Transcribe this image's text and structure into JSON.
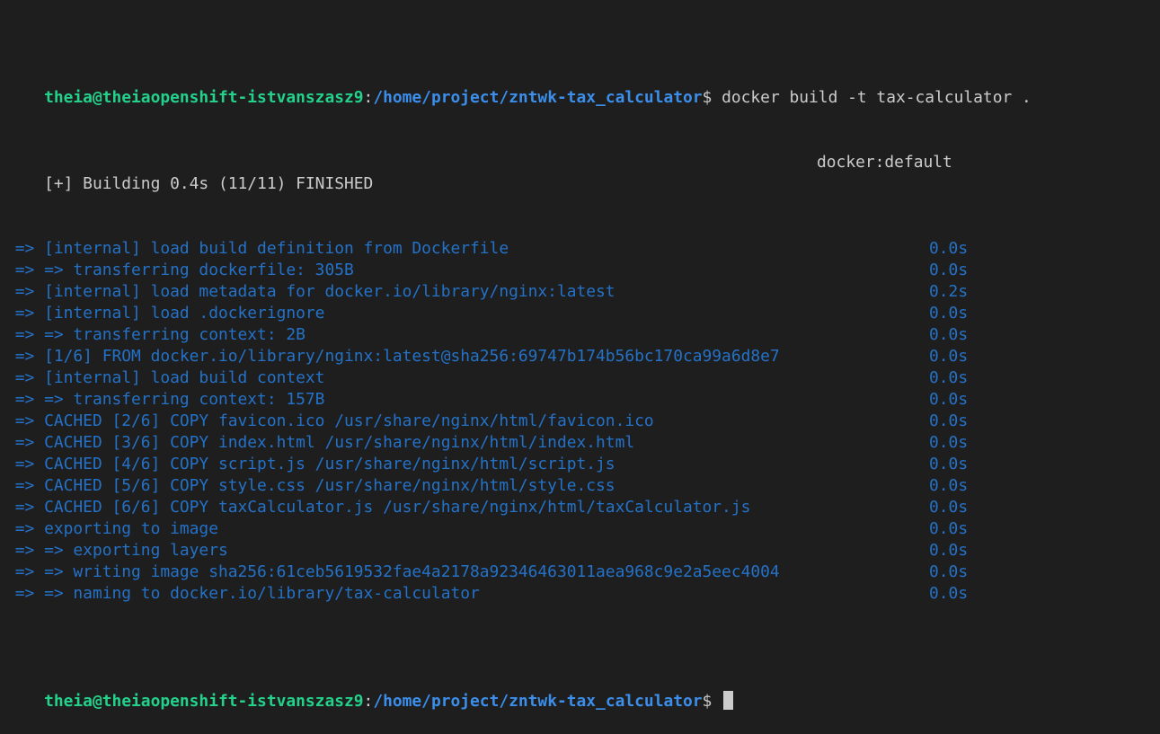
{
  "prompt": {
    "user_host": "theia@theiaopenshift-istvanszasz9",
    "sep": ":",
    "path": "/home/project/zntwk-tax_calculator",
    "dollar": "$"
  },
  "command": " docker build -t tax-calculator .",
  "status": {
    "left": "[+] Building 0.4s (11/11) FINISHED",
    "right": "docker:default"
  },
  "steps": [
    {
      "text": " => [internal] load build definition from Dockerfile",
      "time": "0.0s"
    },
    {
      "text": " => => transferring dockerfile: 305B",
      "time": "0.0s"
    },
    {
      "text": " => [internal] load metadata for docker.io/library/nginx:latest",
      "time": "0.2s"
    },
    {
      "text": " => [internal] load .dockerignore",
      "time": "0.0s"
    },
    {
      "text": " => => transferring context: 2B",
      "time": "0.0s"
    },
    {
      "text": " => [1/6] FROM docker.io/library/nginx:latest@sha256:69747b174b56bc170ca99a6d8e7",
      "time": "0.0s"
    },
    {
      "text": " => [internal] load build context",
      "time": "0.0s"
    },
    {
      "text": " => => transferring context: 157B",
      "time": "0.0s"
    },
    {
      "text": " => CACHED [2/6] COPY favicon.ico /usr/share/nginx/html/favicon.ico",
      "time": "0.0s"
    },
    {
      "text": " => CACHED [3/6] COPY index.html /usr/share/nginx/html/index.html",
      "time": "0.0s"
    },
    {
      "text": " => CACHED [4/6] COPY script.js /usr/share/nginx/html/script.js",
      "time": "0.0s"
    },
    {
      "text": " => CACHED [5/6] COPY style.css /usr/share/nginx/html/style.css",
      "time": "0.0s"
    },
    {
      "text": " => CACHED [6/6] COPY taxCalculator.js /usr/share/nginx/html/taxCalculator.js",
      "time": "0.0s"
    },
    {
      "text": " => exporting to image",
      "time": "0.0s"
    },
    {
      "text": " => => exporting layers",
      "time": "0.0s"
    },
    {
      "text": " => => writing image sha256:61ceb5619532fae4a2178a92346463011aea968c9e2a5eec4004",
      "time": "0.0s"
    },
    {
      "text": " => => naming to docker.io/library/tax-calculator",
      "time": "0.0s"
    }
  ],
  "colors": {
    "background": "#1e1e1e",
    "prompt_user": "#23d18b",
    "prompt_path": "#3b8eea",
    "step_blue": "#2472c8",
    "text": "#cccccc"
  }
}
